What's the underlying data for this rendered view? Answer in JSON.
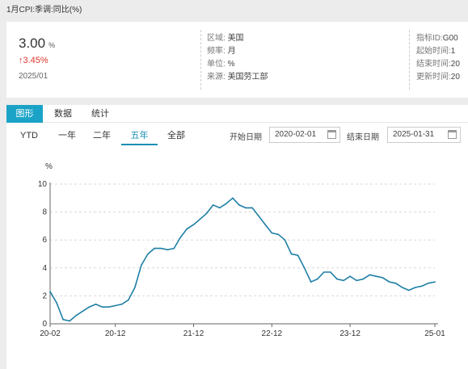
{
  "page_title": "1月CPI:季调:同比(%)",
  "summary": {
    "value": "3.00",
    "unit": "%",
    "change": "↑3.45%",
    "date": "2025/01"
  },
  "meta_left": [
    {
      "key": "区域:",
      "value": "美国"
    },
    {
      "key": "频率:",
      "value": "月"
    },
    {
      "key": "单位:",
      "value": "%"
    },
    {
      "key": "来源:",
      "value": "美国劳工部"
    }
  ],
  "meta_right": [
    {
      "key": "指标ID:",
      "value": "G00"
    },
    {
      "key": "起始时间:",
      "value": "1"
    },
    {
      "key": "结束时间:",
      "value": "20"
    },
    {
      "key": "更新时间:",
      "value": "20"
    }
  ],
  "tabs": [
    "图形",
    "数据",
    "统计"
  ],
  "ranges": [
    "YTD",
    "一年",
    "二年",
    "五年",
    "全部"
  ],
  "active_range": "五年",
  "date_filter": {
    "start_label": "开始日期",
    "start_value": "2020-02-01",
    "end_label": "结束日期",
    "end_value": "2025-01-31"
  },
  "colors": {
    "line": "#1f7fa6",
    "accent": "#1aa3c7",
    "up": "#e0362c"
  },
  "chart_data": {
    "type": "line",
    "ylabel": "%",
    "ylim": [
      0,
      10
    ],
    "yticks": [
      0,
      2,
      4,
      6,
      8,
      10
    ],
    "xticks": [
      "20-02",
      "20-12",
      "21-12",
      "22-12",
      "23-12",
      "25-01"
    ],
    "xtick_index": [
      0,
      10,
      22,
      34,
      46,
      59
    ],
    "grid": true,
    "series": [
      {
        "values": [
          2.3,
          1.5,
          0.3,
          0.2,
          0.6,
          0.9,
          1.2,
          1.4,
          1.2,
          1.2,
          1.3,
          1.4,
          1.7,
          2.6,
          4.2,
          5.0,
          5.4,
          5.4,
          5.3,
          5.4,
          6.2,
          6.8,
          7.1,
          7.5,
          7.9,
          8.5,
          8.3,
          8.6,
          9.0,
          8.5,
          8.3,
          8.3,
          7.7,
          7.1,
          6.5,
          6.4,
          6.0,
          5.0,
          4.9,
          4.0,
          3.0,
          3.2,
          3.7,
          3.7,
          3.2,
          3.1,
          3.4,
          3.1,
          3.2,
          3.5,
          3.4,
          3.3,
          3.0,
          2.9,
          2.6,
          2.4,
          2.6,
          2.7,
          2.9,
          3.0
        ]
      }
    ]
  }
}
